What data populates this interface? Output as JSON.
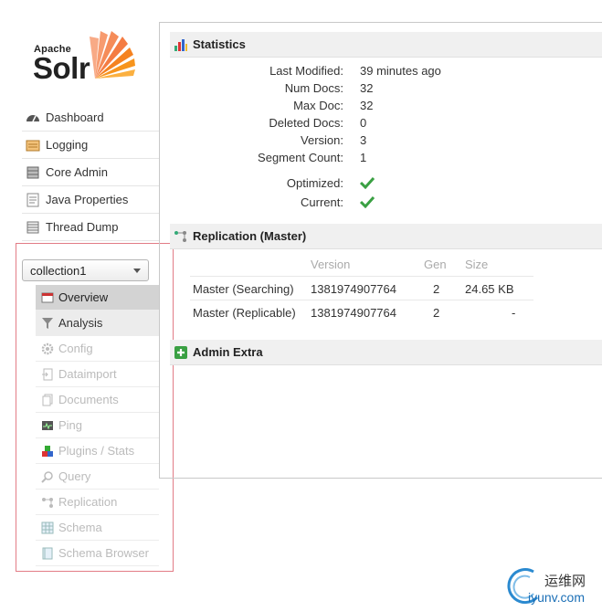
{
  "logo": {
    "apache": "Apache",
    "solr": "Solr"
  },
  "nav": {
    "items": [
      {
        "label": "Dashboard",
        "icon": "dashboard-icon"
      },
      {
        "label": "Logging",
        "icon": "logging-icon"
      },
      {
        "label": "Core Admin",
        "icon": "core-admin-icon"
      },
      {
        "label": "Java Properties",
        "icon": "java-properties-icon"
      },
      {
        "label": "Thread Dump",
        "icon": "thread-dump-icon"
      }
    ]
  },
  "core_selector": {
    "value": "collection1"
  },
  "core_menu": {
    "items": [
      {
        "label": "Overview"
      },
      {
        "label": "Analysis"
      },
      {
        "label": "Config"
      },
      {
        "label": "Dataimport"
      },
      {
        "label": "Documents"
      },
      {
        "label": "Ping"
      },
      {
        "label": "Plugins / Stats"
      },
      {
        "label": "Query"
      },
      {
        "label": "Replication"
      },
      {
        "label": "Schema"
      },
      {
        "label": "Schema Browser"
      }
    ]
  },
  "statistics": {
    "title": "Statistics",
    "rows": [
      {
        "key": "Last Modified:",
        "value": "39 minutes ago"
      },
      {
        "key": "Num Docs:",
        "value": "32"
      },
      {
        "key": "Max Doc:",
        "value": "32"
      },
      {
        "key": "Deleted Docs:",
        "value": "0"
      },
      {
        "key": "Version:",
        "value": "3"
      },
      {
        "key": "Segment Count:",
        "value": "1"
      }
    ],
    "optimized_label": "Optimized:",
    "current_label": "Current:"
  },
  "replication": {
    "title": "Replication (Master)",
    "headers": {
      "version": "Version",
      "gen": "Gen",
      "size": "Size"
    },
    "rows": [
      {
        "name": "Master (Searching)",
        "version": "1381974907764",
        "gen": "2",
        "size": "24.65 KB"
      },
      {
        "name": "Master (Replicable)",
        "version": "1381974907764",
        "gen": "2",
        "size": "-"
      }
    ]
  },
  "admin_extra": {
    "title": "Admin Extra"
  },
  "watermark": {
    "cn": "运维网",
    "url": "iyunv.com"
  },
  "colors": {
    "check": "#3aa043",
    "highlight_border": "#e27c86",
    "logo_sun": "#f26522"
  }
}
